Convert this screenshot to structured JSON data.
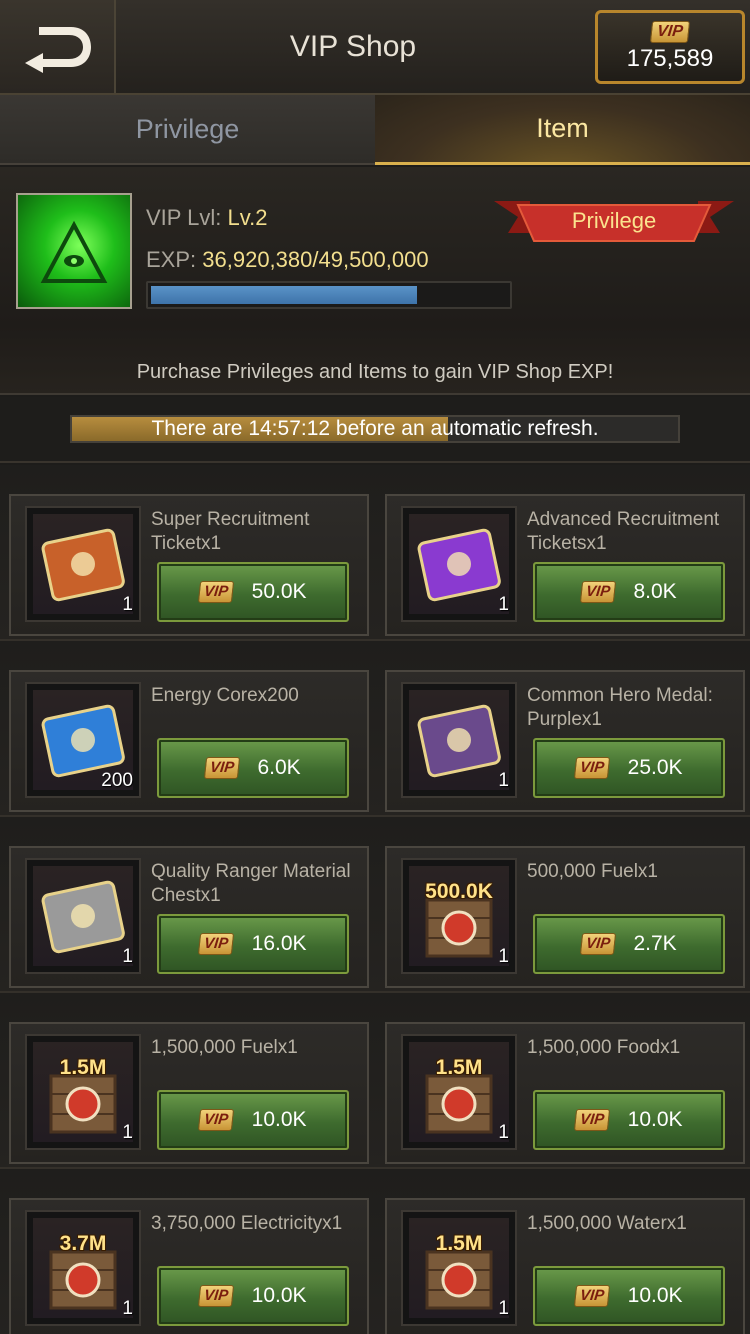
{
  "header": {
    "title": "VIP Shop",
    "vip_badge": "VIP",
    "vip_balance": "175,589"
  },
  "tabs": [
    {
      "label": "Privilege",
      "active": false
    },
    {
      "label": "Item",
      "active": true
    }
  ],
  "info": {
    "vip_lvl_label": "VIP Lvl:",
    "vip_lvl_value": "Lv.2",
    "exp_label": "EXP:",
    "exp_value": "36,920,380/49,500,000",
    "exp_progress_fraction": 0.746,
    "privilege_button": "Privilege",
    "note": "Purchase Privileges and Items to gain VIP Shop EXP!"
  },
  "refresh": {
    "text": "There are 14:57:12 before an automatic refresh.",
    "progress_fraction": 0.62
  },
  "items": [
    {
      "name": "Super Recruitment Ticketx1",
      "count": "1",
      "amount": "",
      "price": "50.0K",
      "icon": "super-recruitment-ticket-icon",
      "color": "#c8612a"
    },
    {
      "name": "Advanced Recruitment Ticketsx1",
      "count": "1",
      "amount": "",
      "price": "8.0K",
      "icon": "advanced-recruitment-ticket-icon",
      "color": "#8a3ad0"
    },
    {
      "name": "Energy Corex200",
      "count": "200",
      "amount": "",
      "price": "6.0K",
      "icon": "energy-core-icon",
      "color": "#2f7fd8"
    },
    {
      "name": "Common Hero Medal: Purplex1",
      "count": "1",
      "amount": "",
      "price": "25.0K",
      "icon": "hero-medal-icon",
      "color": "#6a4a8c"
    },
    {
      "name": "Quality Ranger Material Chestx1",
      "count": "1",
      "amount": "",
      "price": "16.0K",
      "icon": "material-chest-icon",
      "color": "#9a9a9a"
    },
    {
      "name": "500,000 Fuelx1",
      "count": "1",
      "amount": "500.0K",
      "price": "2.7K",
      "icon": "fuel-crate-icon",
      "color": "#d03a2a"
    },
    {
      "name": "1,500,000 Fuelx1",
      "count": "1",
      "amount": "1.5M",
      "price": "10.0K",
      "icon": "fuel-crate-icon",
      "color": "#d03a2a"
    },
    {
      "name": "1,500,000 Foodx1",
      "count": "1",
      "amount": "1.5M",
      "price": "10.0K",
      "icon": "food-crate-icon",
      "color": "#d03a2a"
    },
    {
      "name": "3,750,000 Electricityx1",
      "count": "1",
      "amount": "3.7M",
      "price": "10.0K",
      "icon": "electricity-crate-icon",
      "color": "#d03a2a"
    },
    {
      "name": "1,500,000 Waterx1",
      "count": "1",
      "amount": "1.5M",
      "price": "10.0K",
      "icon": "water-crate-icon",
      "color": "#d03a2a"
    }
  ]
}
